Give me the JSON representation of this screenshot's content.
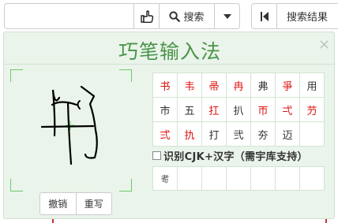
{
  "toolbar": {
    "search_placeholder": "",
    "search_label": "搜索",
    "results_label": "搜索结果",
    "icons": {
      "handwrite": "pointing-hand-icon",
      "search": "search-icon",
      "dropdown": "caret-down-icon",
      "prev": "skip-back-icon"
    }
  },
  "ime": {
    "title": "巧笔输入法",
    "close": "×",
    "candidates": [
      {
        "char": "书",
        "highlight": true
      },
      {
        "char": "韦",
        "highlight": true
      },
      {
        "char": "帚",
        "highlight": true
      },
      {
        "char": "冉",
        "highlight": true
      },
      {
        "char": "弗",
        "highlight": false
      },
      {
        "char": "爭",
        "highlight": true
      },
      {
        "char": "用",
        "highlight": false
      },
      {
        "char": "市",
        "highlight": false
      },
      {
        "char": "五",
        "highlight": false
      },
      {
        "char": "扛",
        "highlight": true
      },
      {
        "char": "扒",
        "highlight": false
      },
      {
        "char": "帀",
        "highlight": true
      },
      {
        "char": "弌",
        "highlight": true
      },
      {
        "char": "芀",
        "highlight": true
      },
      {
        "char": "弍",
        "highlight": true
      },
      {
        "char": "扏",
        "highlight": true
      },
      {
        "char": "打",
        "highlight": false
      },
      {
        "char": "弐",
        "highlight": false
      },
      {
        "char": "夯",
        "highlight": false
      },
      {
        "char": "迈",
        "highlight": false
      }
    ],
    "cjk_label": "识别CJK+汉字（需宇库支持）",
    "cjk_checked": false,
    "radicals": [
      "耉",
      "",
      "",
      "",
      "",
      "",
      ""
    ],
    "undo_label": "撤销",
    "rewrite_label": "重写",
    "colors": {
      "panel_bg": "#eaf4ea",
      "title": "#4a944a",
      "highlight": "#d11111",
      "guide": "#6ccb6c"
    }
  }
}
